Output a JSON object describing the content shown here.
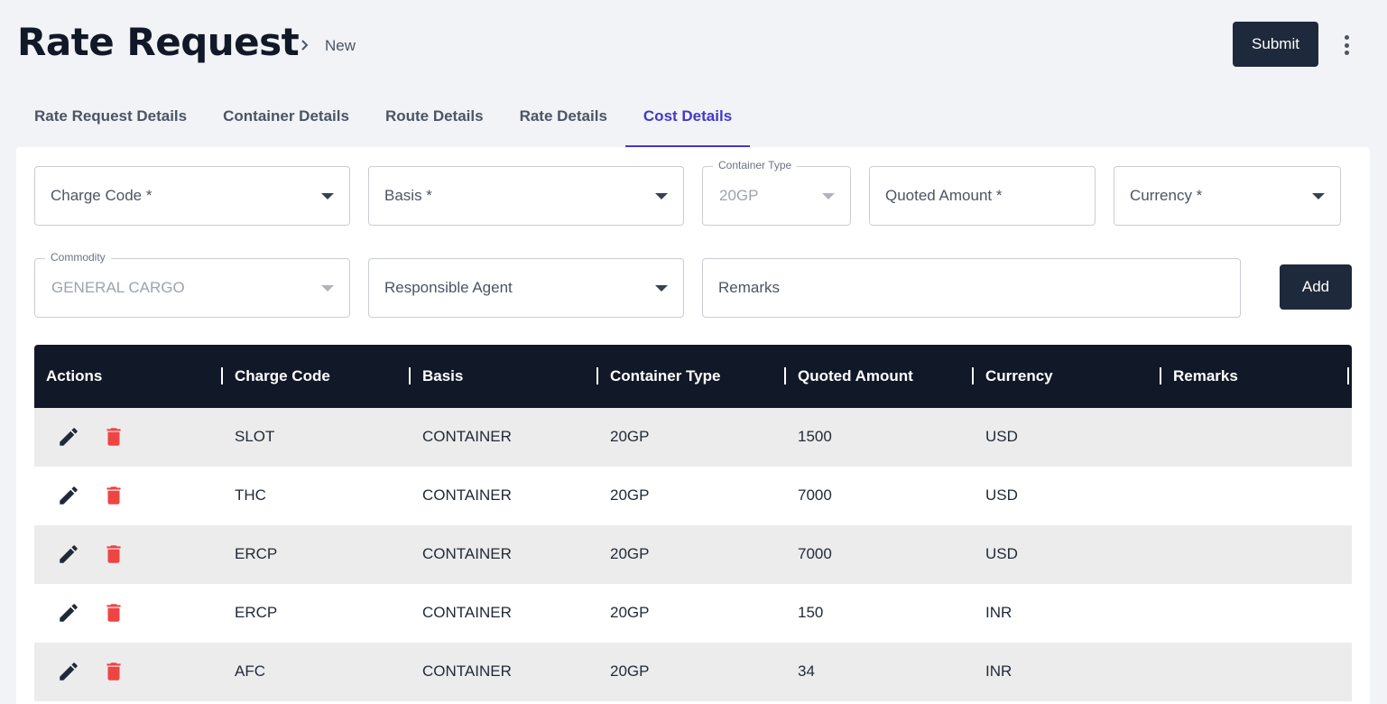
{
  "header": {
    "title": "Rate Request",
    "breadcrumb_current": "New",
    "submit_label": "Submit",
    "more_icon": "more-vertical-icon"
  },
  "tabs": [
    {
      "label": "Rate Request Details",
      "active": false
    },
    {
      "label": "Container Details",
      "active": false
    },
    {
      "label": "Route Details",
      "active": false
    },
    {
      "label": "Rate Details",
      "active": false
    },
    {
      "label": "Cost Details",
      "active": true
    }
  ],
  "form": {
    "charge_code": {
      "placeholder": "Charge Code *"
    },
    "basis": {
      "placeholder": "Basis *"
    },
    "container_type": {
      "label": "Container Type",
      "value": "20GP"
    },
    "quoted_amount": {
      "placeholder": "Quoted Amount *"
    },
    "currency": {
      "placeholder": "Currency *"
    },
    "commodity": {
      "label": "Commodity",
      "value": "GENERAL CARGO"
    },
    "responsible_agent": {
      "placeholder": "Responsible Agent"
    },
    "remarks": {
      "placeholder": "Remarks"
    },
    "add_label": "Add"
  },
  "table": {
    "columns": [
      "Actions",
      "Charge Code",
      "Basis",
      "Container Type",
      "Quoted Amount",
      "Currency",
      "Remarks"
    ],
    "rows": [
      {
        "charge_code": "SLOT",
        "basis": "CONTAINER",
        "container_type": "20GP",
        "quoted_amount": "1500",
        "currency": "USD",
        "remarks": ""
      },
      {
        "charge_code": "THC",
        "basis": "CONTAINER",
        "container_type": "20GP",
        "quoted_amount": "7000",
        "currency": "USD",
        "remarks": ""
      },
      {
        "charge_code": "ERCP",
        "basis": "CONTAINER",
        "container_type": "20GP",
        "quoted_amount": "7000",
        "currency": "USD",
        "remarks": ""
      },
      {
        "charge_code": "ERCP",
        "basis": "CONTAINER",
        "container_type": "20GP",
        "quoted_amount": "150",
        "currency": "INR",
        "remarks": ""
      },
      {
        "charge_code": "AFC",
        "basis": "CONTAINER",
        "container_type": "20GP",
        "quoted_amount": "34",
        "currency": "INR",
        "remarks": ""
      }
    ]
  },
  "colors": {
    "accent": "#4338ca",
    "primary_button": "#1e293b",
    "table_header": "#111827",
    "delete": "#ef4444"
  }
}
